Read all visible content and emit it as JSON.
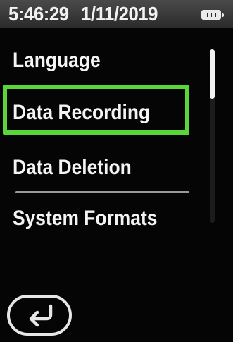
{
  "status_bar": {
    "time": "5:46:29",
    "date": "1/11/2019",
    "battery_icon": "battery-icon"
  },
  "menu": {
    "items": [
      {
        "label": "Language"
      },
      {
        "label": "Data Recording"
      },
      {
        "label": "Data Deletion"
      },
      {
        "label": "System Formats"
      }
    ],
    "selected_index": 1,
    "selection_color": "#5ad63a"
  },
  "scrollbar": {
    "position": 0
  },
  "back_button": {
    "icon": "return-arrow-icon"
  },
  "colors": {
    "background": "#050505",
    "text": "#f4f4f4",
    "accent": "#5ad63a"
  }
}
